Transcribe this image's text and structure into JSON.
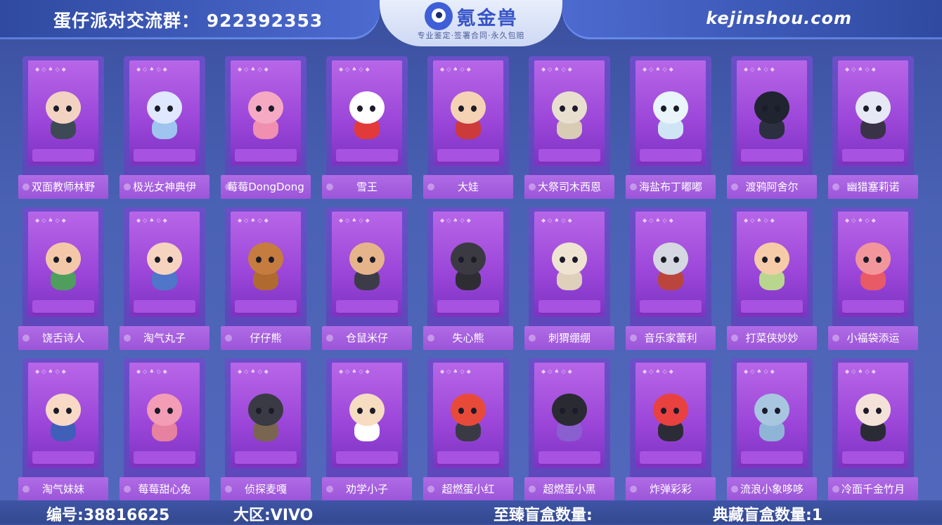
{
  "header": {
    "group": "蛋仔派对交流群：  922392353",
    "logo_name": "氪金兽",
    "slogan": "专业鉴定·签署合同·永久包赔",
    "site": "kejinshou.com"
  },
  "cards": [
    {
      "name": "双面教师林野",
      "head": "#f2d3c2",
      "body": "#3d4a55"
    },
    {
      "name": "极光女神典伊",
      "head": "#dfe8ff",
      "body": "#9fc4f0"
    },
    {
      "name": "莓莓DongDong",
      "head": "#f5a9c3",
      "body": "#f08fb0"
    },
    {
      "name": "雪王",
      "head": "#ffffff",
      "body": "#e23a3a"
    },
    {
      "name": "大娃",
      "head": "#f6d2b5",
      "body": "#cc3a3a"
    },
    {
      "name": "大祭司木西恩",
      "head": "#e8dfcf",
      "body": "#d8ccb4"
    },
    {
      "name": "海盐布丁嘟嘟",
      "head": "#e9f4fb",
      "body": "#cfe5f5"
    },
    {
      "name": "渡鸦阿舍尔",
      "head": "#202330",
      "body": "#2c2f40"
    },
    {
      "name": "幽猎塞莉诺",
      "head": "#e6e8f5",
      "body": "#3a3348"
    },
    {
      "name": "饶舌诗人",
      "head": "#f3c8a8",
      "body": "#4f9e5e"
    },
    {
      "name": "淘气丸子",
      "head": "#f6d3bf",
      "body": "#4f76c8"
    },
    {
      "name": "仔仔熊",
      "head": "#c57c3e",
      "body": "#b06a30"
    },
    {
      "name": "仓鼠米仔",
      "head": "#e6b48a",
      "body": "#3c3c48"
    },
    {
      "name": "失心熊",
      "head": "#3b3a42",
      "body": "#2e2d33"
    },
    {
      "name": "刺猬绷绷",
      "head": "#efe3d2",
      "body": "#dfd0bb"
    },
    {
      "name": "音乐家蕾利",
      "head": "#d5d8e0",
      "body": "#b9453c"
    },
    {
      "name": "打菜侠妙妙",
      "head": "#f5cba8",
      "body": "#b9d68f"
    },
    {
      "name": "小福袋添运",
      "head": "#f2969c",
      "body": "#e85a66"
    },
    {
      "name": "淘气妹妹",
      "head": "#f8d9c5",
      "body": "#3f5fb8"
    },
    {
      "name": "莓莓甜心兔",
      "head": "#f39cb5",
      "body": "#e6819f"
    },
    {
      "name": "侦探麦嘎",
      "head": "#3a3a44",
      "body": "#7a6650"
    },
    {
      "name": "劝学小子",
      "head": "#f6dcc0",
      "body": "#ffffff"
    },
    {
      "name": "超燃蛋小红",
      "head": "#e84a3a",
      "body": "#3a3a44"
    },
    {
      "name": "超燃蛋小黑",
      "head": "#2a2a33",
      "body": "#8a5fd0"
    },
    {
      "name": "炸弹彩彩",
      "head": "#e8413f",
      "body": "#2c2c36"
    },
    {
      "name": "流浪小象哆哆",
      "head": "#a8c6e0",
      "body": "#8fb5d6"
    },
    {
      "name": "冷面千金竹月",
      "head": "#f4e2d8",
      "body": "#2b2b35"
    }
  ],
  "footer": {
    "number": "编号:38816625",
    "region": "大区:VIVO",
    "zhizhen": "至臻盲盒数量:",
    "diancang": "典藏盲盒数量:1"
  }
}
